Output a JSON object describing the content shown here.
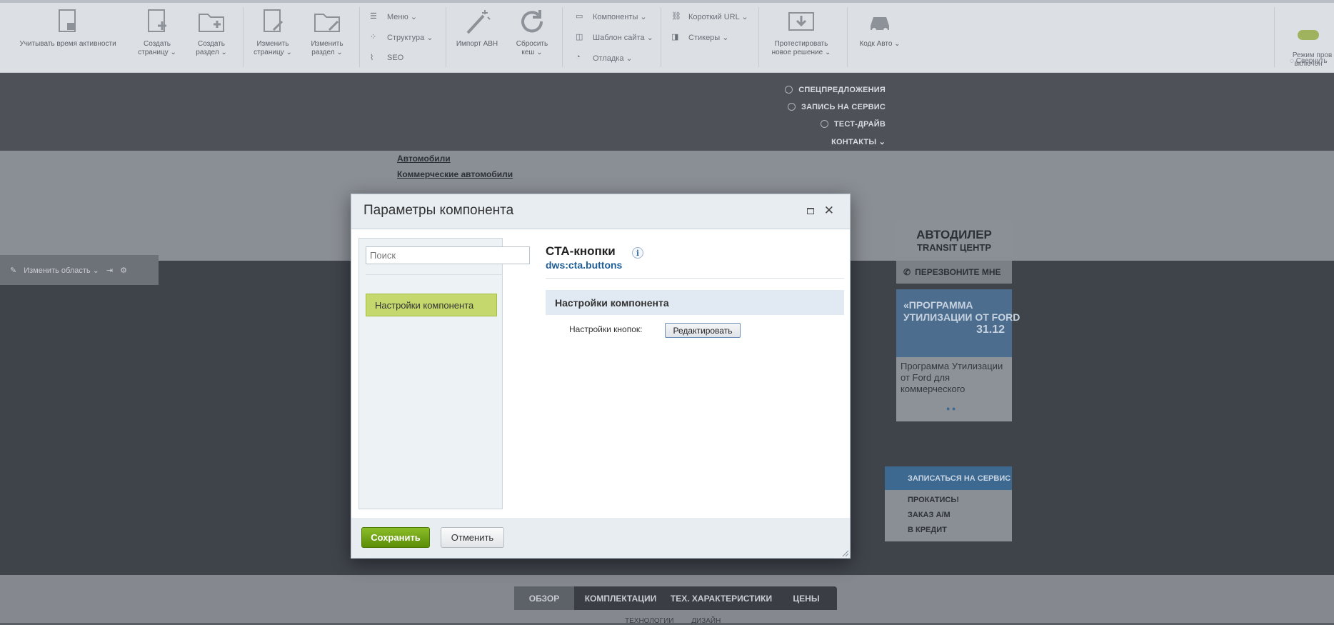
{
  "admin_panel": {
    "buttons": [
      {
        "label": "Учитывать время активности"
      },
      {
        "label": "Создать\nстраницу ⌄"
      },
      {
        "label": "Создать\nраздел ⌄"
      },
      {
        "label": "Изменить\nстраницу ⌄"
      },
      {
        "label": "Изменить\nраздел ⌄"
      },
      {
        "label": "Импорт АВН"
      },
      {
        "label": "Сбросить\nкеш ⌄"
      },
      {
        "label": "Протестировать\nновое решение ⌄"
      },
      {
        "label": "Кодк Авто ⌄"
      }
    ],
    "small_items": [
      {
        "label": "Меню ⌄"
      },
      {
        "label": "Структура ⌄"
      },
      {
        "label": "SEO"
      },
      {
        "label": "Компоненты ⌄"
      },
      {
        "label": "Шаблон сайта ⌄"
      },
      {
        "label": "Отладка ⌄"
      },
      {
        "label": "Короткий URL ⌄"
      },
      {
        "label": "Стикеры ⌄"
      }
    ],
    "right_mode": "Режим пров\nвключен",
    "collapse": "Свернуть"
  },
  "site": {
    "header_links": [
      "СПЕЦПРЕДЛОЖЕНИЯ",
      "ЗАПИСЬ НА СЕРВИС",
      "ТЕСТ-ДРАЙВ",
      "КОНТАКТЫ ⌄"
    ],
    "crumbs": [
      "Автомобили",
      "Коммерческие автомобили"
    ],
    "edit_area": "Изменить область ⌄",
    "dealer_title": "АВТОДИЛЕР",
    "dealer_sub": "TRANSIT ЦЕНТР",
    "callback": "ПЕРЕЗВОНИТЕ МНЕ",
    "promo_img_text": "«ПРОГРАММА\nУТИЛИЗАЦИИ ОТ FORD",
    "promo_date": "31.12",
    "promo_text": "Программа Утилизации от Ford для коммерческого",
    "service_head": "ЗАПИСАТЬСЯ НА СЕРВИС",
    "service_items": [
      "ПРОКАТИСЬ!",
      "ЗАКАЗ А/М",
      "В КРЕДИТ"
    ],
    "footer_tabs": [
      "ОБЗОР",
      "КОМПЛЕКТАЦИИ",
      "ТЕХ. ХАРАКТЕРИСТИКИ",
      "ЦЕНЫ"
    ],
    "footer_sub": [
      "ТЕХНОЛОГИИ",
      "ДИЗАЙН"
    ]
  },
  "dialog": {
    "title": "Параметры компонента",
    "search_placeholder": "Поиск",
    "nav_item": "Настройки компонента",
    "component_name": "CTA-кнопки",
    "info_glyph": "i",
    "component_code": "dws:cta.buttons",
    "section_title": "Настройки компонента",
    "param_label": "Настройки кнопок:",
    "edit_button": "Редактировать",
    "save_button": "Сохранить",
    "cancel_button": "Отменить"
  }
}
